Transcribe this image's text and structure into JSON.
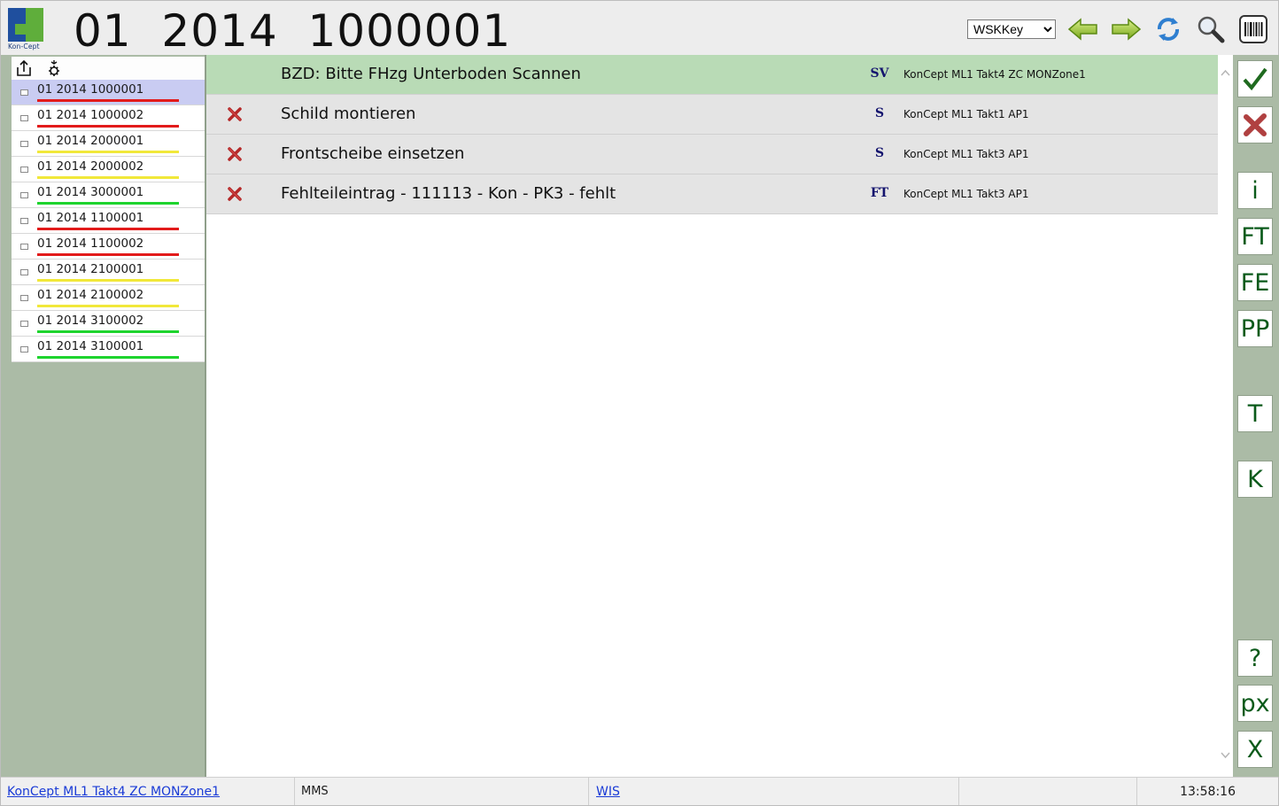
{
  "header": {
    "logo_text": "Kon-Cept",
    "title": "01  2014  1000001",
    "key_select": {
      "selected": "WSKKey",
      "options": [
        "WSKKey"
      ]
    },
    "tools": [
      "arrow-left-icon",
      "arrow-right-icon",
      "refresh-icon",
      "magnifier-icon",
      "barcode-icon"
    ]
  },
  "left_panel": {
    "toolbar": [
      "export-icon",
      "settings-gear-icon"
    ],
    "orders": [
      {
        "label": "01 2014 1000001",
        "status_color": "#e21b1b",
        "selected": true
      },
      {
        "label": "01 2014 1000002",
        "status_color": "#e21b1b"
      },
      {
        "label": "01 2014 2000001",
        "status_color": "#f1e83a"
      },
      {
        "label": "01 2014 2000002",
        "status_color": "#f1e83a"
      },
      {
        "label": "01 2014 3000001",
        "status_color": "#1ed42e"
      },
      {
        "label": "01 2014 1100001",
        "status_color": "#e21b1b"
      },
      {
        "label": "01 2014 1100002",
        "status_color": "#e21b1b"
      },
      {
        "label": "01 2014 2100001",
        "status_color": "#f1e83a"
      },
      {
        "label": "01 2014 2100002",
        "status_color": "#f1e83a"
      },
      {
        "label": "01 2014 3100002",
        "status_color": "#1ed42e"
      },
      {
        "label": "01 2014 3100001",
        "status_color": "#1ed42e"
      }
    ]
  },
  "tasks": [
    {
      "text": "BZD: Bitte FHzg Unterboden Scannen",
      "code": "SV",
      "location": "KonCept ML1 Takt4 ZC MONZone1",
      "status_icon": "",
      "active": true
    },
    {
      "text": "Schild montieren",
      "code": "S",
      "location": "KonCept ML1 Takt1 AP1",
      "status_icon": "red-x-icon"
    },
    {
      "text": "Frontscheibe einsetzen",
      "code": "S",
      "location": "KonCept ML1 Takt3 AP1",
      "status_icon": "red-x-icon"
    },
    {
      "text": "Fehlteileintrag - 111113 - Kon - PK3 - fehlt",
      "code": "FT",
      "location": "KonCept ML1 Takt3 AP1",
      "status_icon": "red-x-icon"
    }
  ],
  "actions": {
    "ok_icon": "checkmark-icon",
    "cancel_icon": "cross-icon",
    "info": "i",
    "ft": "FT",
    "fe": "FE",
    "pp": "PP",
    "t": "T",
    "k": "K",
    "help": "?",
    "px": "px",
    "exit": "X"
  },
  "statusbar": {
    "location_link": "KonCept ML1 Takt4 ZC MONZone1",
    "system": "MMS",
    "wis_link": "WIS",
    "time": "13:58:16"
  },
  "colors": {
    "panel_green": "#abbba6",
    "active_row": "#b9dbb6",
    "selected_item": "#c9ccf2",
    "action_text": "#0a5a1a",
    "code_text": "#14146e"
  }
}
